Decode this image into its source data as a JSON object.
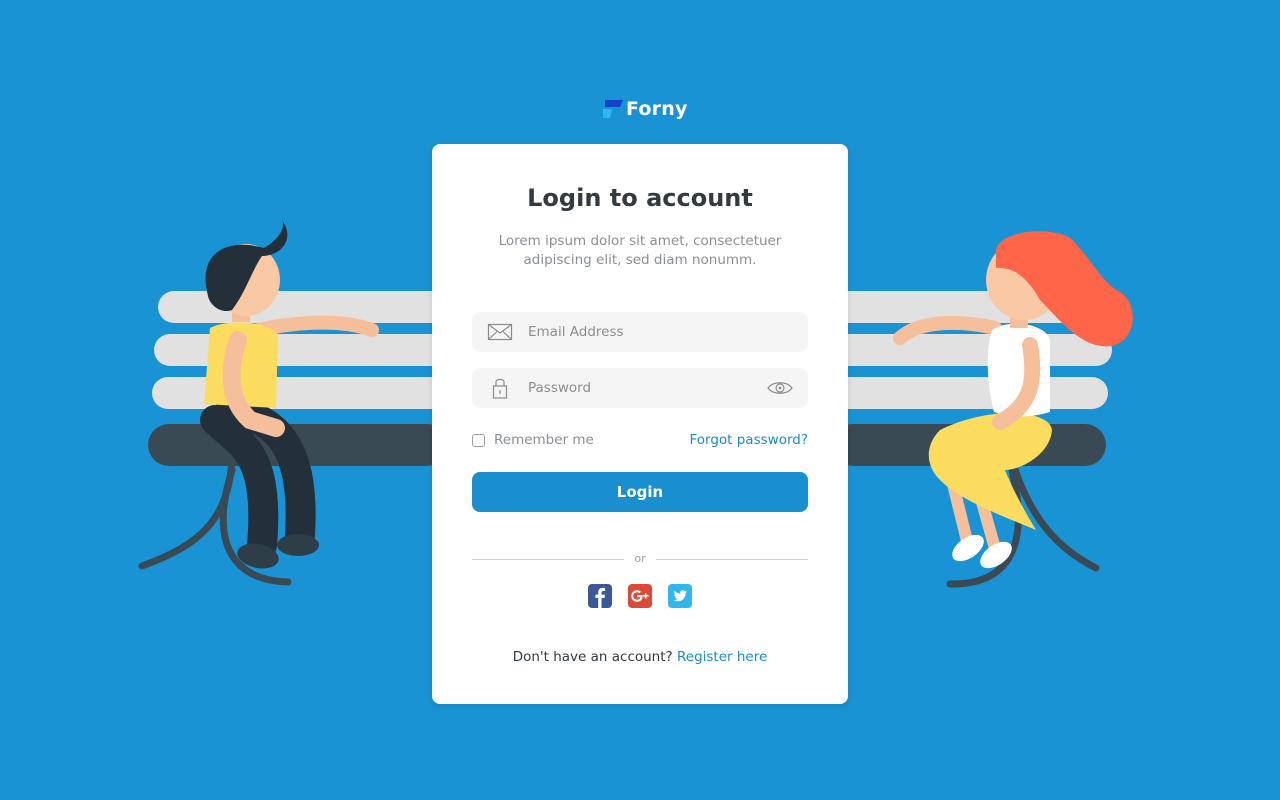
{
  "brand": {
    "name": "Forny",
    "logo_icon": "forny-logo-icon"
  },
  "login_card": {
    "title": "Login to account",
    "subtitle": "Lorem ipsum dolor sit amet, consectetuer adipiscing elit, sed diam nonumm.",
    "email": {
      "value": "",
      "placeholder": "Email Address",
      "icon": "envelope-icon"
    },
    "password": {
      "value": "",
      "placeholder": "Password",
      "icon": "lock-icon",
      "toggle_icon": "eye-icon"
    },
    "remember_me": {
      "label": "Remember me",
      "checked": false
    },
    "forgot_password": "Forgot password?",
    "login_button": "Login",
    "divider_text": "or",
    "social": [
      {
        "name": "facebook-icon",
        "color": "#3b5998"
      },
      {
        "name": "google-plus-icon",
        "color": "#dc4a38"
      },
      {
        "name": "twitter-icon",
        "color": "#2fb7ee"
      }
    ],
    "register_prompt": "Don't have an account?",
    "register_link": "Register here"
  },
  "colors": {
    "background": "#1a93d4",
    "accent": "#1a8fd0",
    "link": "#1a8bc7"
  }
}
